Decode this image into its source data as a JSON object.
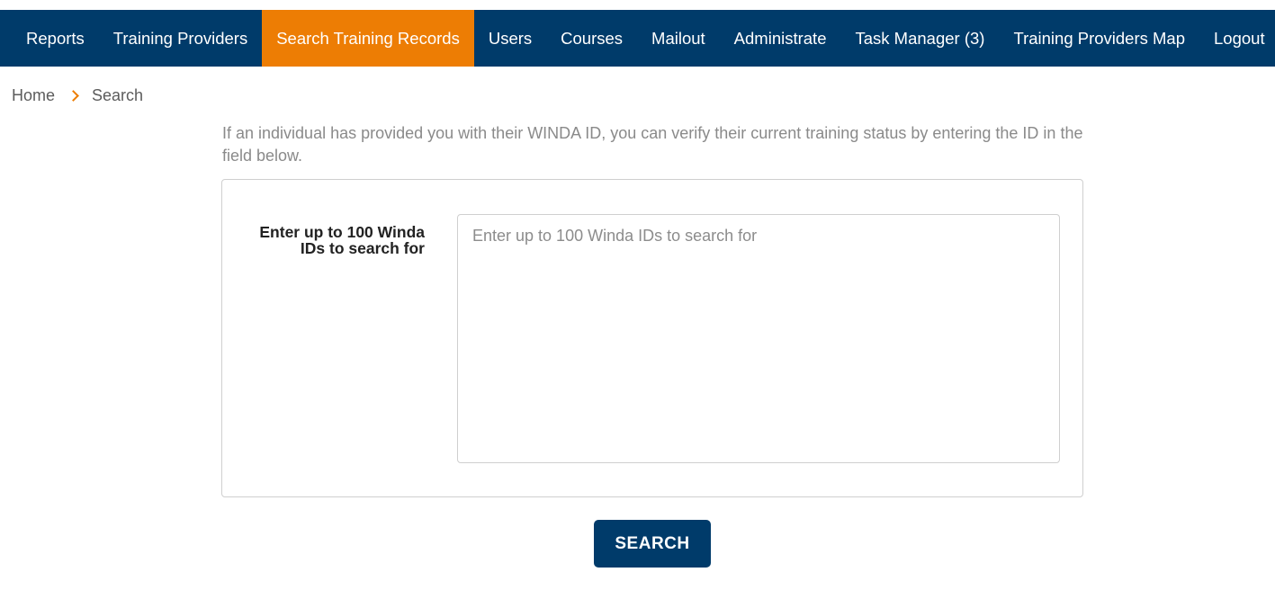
{
  "nav": {
    "items": [
      {
        "label": "Reports"
      },
      {
        "label": "Training Providers"
      },
      {
        "label": "Search Training Records"
      },
      {
        "label": "Users"
      },
      {
        "label": "Courses"
      },
      {
        "label": "Mailout"
      },
      {
        "label": "Administrate"
      },
      {
        "label": "Task Manager (3)"
      },
      {
        "label": "Training Providers Map"
      },
      {
        "label": "Logout"
      }
    ],
    "active_item": "Search Training Records",
    "background_color": "#003b6a",
    "active_color": "#ed7d04"
  },
  "breadcrumb": {
    "home": "Home",
    "current": "Search",
    "separator_icon": "chevron-right-icon"
  },
  "intro_text": "If an individual has provided you with their WINDA ID, you can verify their current training status by entering the ID in the field below.",
  "form": {
    "label": "Enter up to 100 Winda IDs to search for",
    "placeholder": "Enter up to 100 Winda IDs to search for",
    "value": ""
  },
  "search_button": {
    "label": "SEARCH"
  }
}
